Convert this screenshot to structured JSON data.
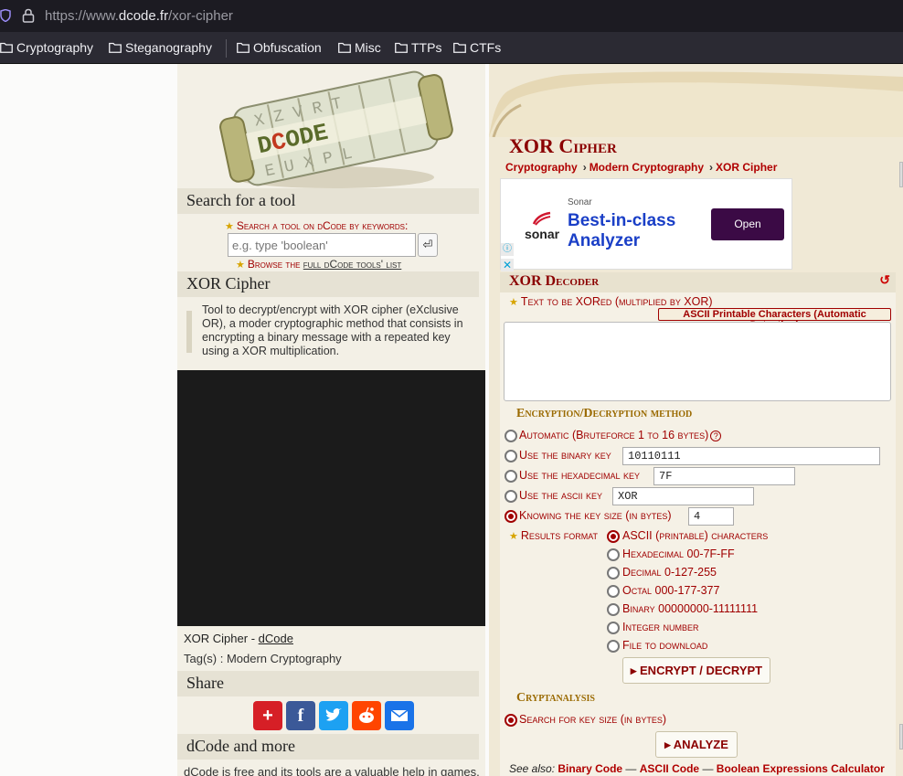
{
  "browser": {
    "url_prefix": "https://www.",
    "url_domain": "dcode.fr",
    "url_path": "/xor-cipher",
    "bookmarks": [
      "Cryptography",
      "Steganography",
      "Obfuscation",
      "Misc",
      "TTPs",
      "CTFs"
    ]
  },
  "logo": {
    "letters": "DCODE",
    "alt": "dCode"
  },
  "sidebar": {
    "search_heading": "Search for a tool",
    "search_label": "Search a tool on dCode by keywords:",
    "search_placeholder": "e.g. type 'boolean'",
    "search_button": "⏎",
    "browse_prefix": "Browse the ",
    "browse_link": "full dCode tools' list",
    "tool_heading": "XOR Cipher",
    "tool_description": "Tool to decrypt/encrypt with XOR cipher (eXclusive OR), a moder cryptographic method that consists in encrypting a binary message with a repeated key using a XOR multiplication.",
    "caption_prefix": "XOR Cipher - ",
    "caption_link": "dCode",
    "tags": "Tag(s) : Modern Cryptography",
    "share_heading": "Share",
    "share_buttons": [
      "add-icon",
      "facebook-icon",
      "twitter-icon",
      "reddit-icon",
      "email-icon"
    ],
    "more_heading": "dCode and more",
    "more_text": "dCode is free and its tools are a valuable help in games,"
  },
  "main": {
    "title": "XOR Cipher",
    "breadcrumbs": [
      "Cryptography",
      "Modern Cryptography",
      "XOR Cipher"
    ],
    "ad": {
      "small": "Sonar",
      "brand": "sonar",
      "headline_1": "Best-in-class",
      "headline_2": "Analyzer",
      "button": "Open",
      "info": "ⓘ",
      "close": "✕"
    },
    "decoder": {
      "heading": "XOR Decoder",
      "reset": "↺",
      "text_label": "Text to be XORed (multiplied by XOR)",
      "detection_badge": "ASCII Printable Characters (Automatic Detection)",
      "text_value": "",
      "method_heading": "Encryption/Decryption method",
      "methods": [
        {
          "label": "Automatic (Bruteforce 1 to 16 bytes)",
          "selected": false
        },
        {
          "label": "Use the binary key",
          "value": "10110111",
          "selected": false
        },
        {
          "label": "Use the hexadecimal key",
          "value": "7F",
          "selected": false
        },
        {
          "label": "Use the ascii key",
          "value": "XOR",
          "selected": false
        },
        {
          "label": "Knowing the key size (in bytes)",
          "value": "4",
          "selected": true
        }
      ],
      "results_label": "Results format",
      "formats": [
        {
          "label": "ASCII (printable) characters",
          "selected": true
        },
        {
          "label": "Hexadecimal 00-7F-FF",
          "selected": false
        },
        {
          "label": "Decimal 0-127-255",
          "selected": false
        },
        {
          "label": "Octal 000-177-377",
          "selected": false
        },
        {
          "label": "Binary 00000000-11111111",
          "selected": false
        },
        {
          "label": "Integer number",
          "selected": false
        },
        {
          "label": "File to download",
          "selected": false
        }
      ],
      "encrypt_button": "▸ ENCRYPT / DECRYPT",
      "cryptanalysis_heading": "Cryptanalysis",
      "cryptanalysis_option": "Search for key size (in bytes)",
      "analyze_button": "▸ ANALYZE",
      "see_also_label": "See also:",
      "see_also": [
        "Binary Code",
        "ASCII Code",
        "Boolean Expressions Calculator"
      ]
    }
  }
}
